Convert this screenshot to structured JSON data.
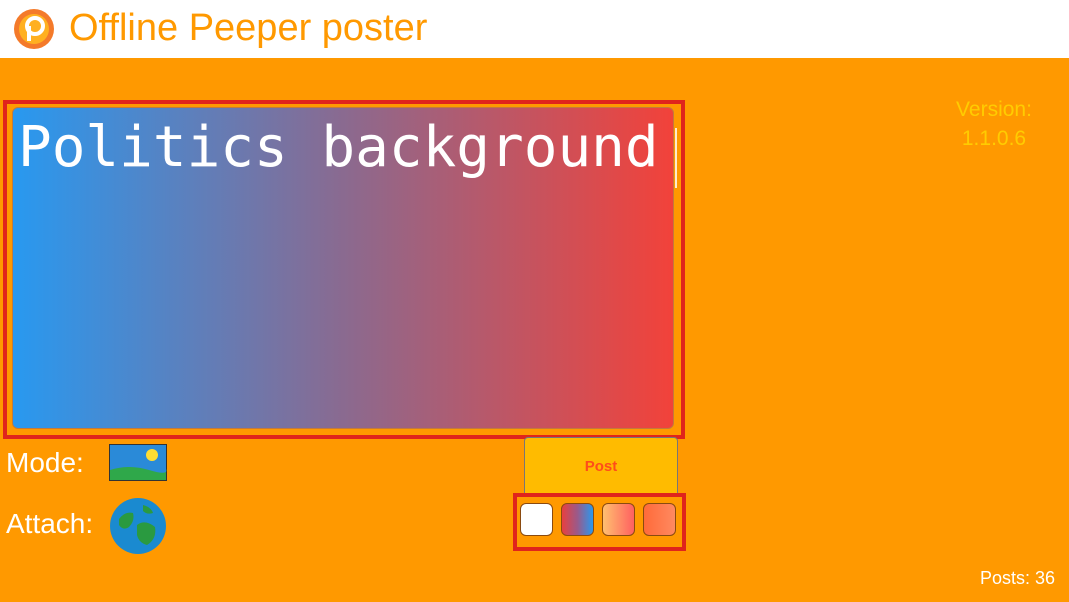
{
  "header": {
    "title": "Offline Peeper poster",
    "logo_icon": "peeper-logo-icon"
  },
  "version": {
    "label": "Version:",
    "number": "1.1.0.6"
  },
  "editor": {
    "text": "Politics background",
    "background_name": "Politics"
  },
  "mode": {
    "label": "Mode:",
    "icon": "image-mode-icon"
  },
  "attach": {
    "label": "Attach:",
    "icon": "globe-icon"
  },
  "actions": {
    "post_label": "Post"
  },
  "backgrounds": [
    {
      "name": "white",
      "color": "#ffffff"
    },
    {
      "name": "politics",
      "color": "#e84040"
    },
    {
      "name": "peach",
      "color": "#ffc070"
    },
    {
      "name": "coral",
      "color": "#ff6a3a"
    }
  ],
  "footer": {
    "posts_count": "Posts: 36"
  },
  "colors": {
    "background": "#ff9900",
    "accent": "#ff9900",
    "highlight": "#e0241c",
    "button": "#ffbb00",
    "version_text": "#ffcc00"
  }
}
